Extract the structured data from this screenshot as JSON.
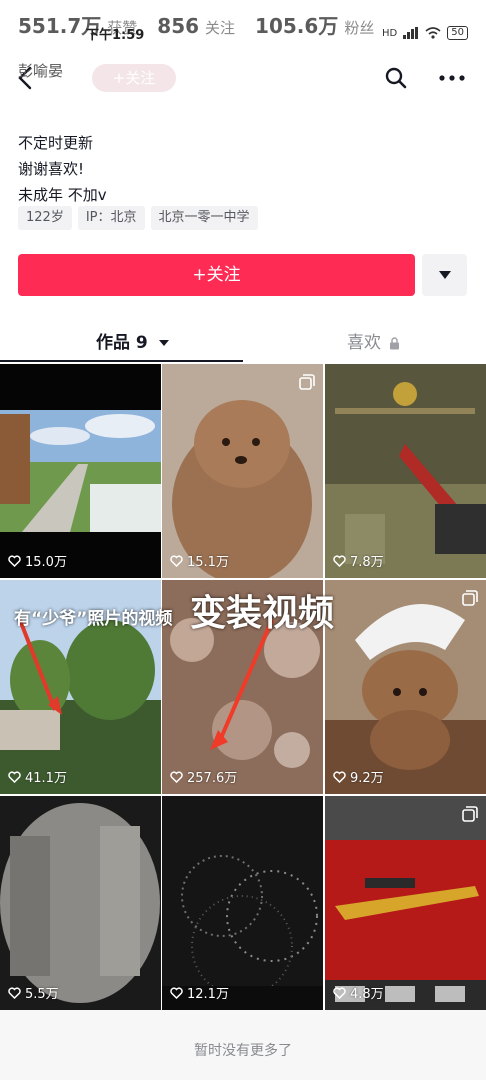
{
  "stats": {
    "likes_num": "551.7万",
    "likes_label": "获赞",
    "following_num": "856",
    "following_label": "关注",
    "fans_num": "105.6万",
    "fans_label": "粉丝"
  },
  "status_bar": {
    "time": "下午1:59",
    "network": "HD",
    "battery": "50"
  },
  "nav": {
    "name": "彭喻晏",
    "follow_pill": "+关注"
  },
  "bio": {
    "lines": [
      "不定时更新",
      "谢谢喜欢!",
      "未成年 不加v"
    ]
  },
  "tags": [
    "122岁",
    "IP：北京",
    "北京一零一中学"
  ],
  "actions": {
    "follow_label": "+关注"
  },
  "tabs": {
    "works": "作品 9",
    "likes": "喜欢"
  },
  "overlays": {
    "photo_note": "有“少爷”照片的视频",
    "costume_note": "变装视频"
  },
  "videos": [
    {
      "likes": "15.0万",
      "thumb": "meadow-path",
      "multi": false
    },
    {
      "likes": "15.1万",
      "thumb": "poodle",
      "multi": true
    },
    {
      "likes": "7.8万",
      "thumb": "game-knife",
      "multi": false
    },
    {
      "likes": "41.1万",
      "thumb": "trees-street",
      "multi": false
    },
    {
      "likes": "257.6万",
      "thumb": "bokeh-costume",
      "multi": false
    },
    {
      "likes": "9.2万",
      "thumb": "poodle-hat",
      "multi": true
    },
    {
      "likes": "5.5万",
      "thumb": "blurry-wall",
      "multi": false
    },
    {
      "likes": "12.1万",
      "thumb": "fireworks",
      "multi": false
    },
    {
      "likes": "4.8万",
      "thumb": "game-rifle",
      "multi": true
    }
  ],
  "footer": {
    "text": "暂时没有更多了"
  },
  "colors": {
    "accent": "#fe2c55",
    "text": "#161823",
    "muted": "#8a8b91"
  }
}
